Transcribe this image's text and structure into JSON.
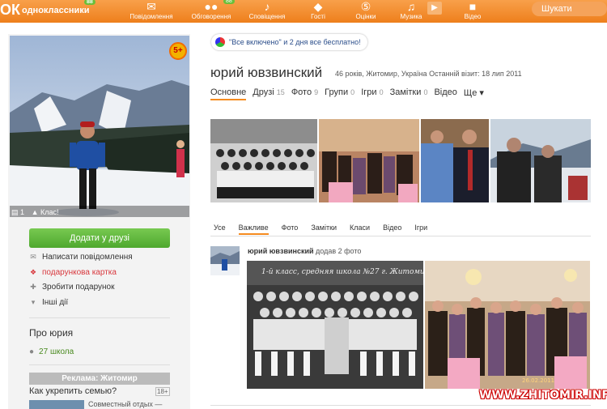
{
  "logo": {
    "text": "одноклассники",
    "badge": "88"
  },
  "nav": [
    {
      "label": "Повідомлення",
      "icon": "envelope-icon"
    },
    {
      "label": "Обговорення",
      "icon": "chat-bubbles-icon",
      "count": "88"
    },
    {
      "label": "Сповіщення",
      "icon": "bell-icon"
    },
    {
      "label": "Гості",
      "icon": "footprints-icon"
    },
    {
      "label": "Оцінки",
      "icon": "rating-icon",
      "count": "5"
    },
    {
      "label": "Музика",
      "icon": "music-note-icon"
    },
    {
      "label": "Відео",
      "icon": "video-camera-icon"
    }
  ],
  "search": {
    "placeholder": "Шукати"
  },
  "profile": {
    "rating_badge": "5+",
    "comments_count": "1",
    "like_label": "Клас!",
    "add_friend": "Додати у друзі",
    "actions": [
      {
        "label": "Написати повідомлення",
        "icon": "envelope-icon"
      },
      {
        "label": "подарункова картка",
        "icon": "gift-card-icon"
      },
      {
        "label": "Зробити подарунок",
        "icon": "gift-icon"
      },
      {
        "label": "Інші дії",
        "icon": "chevron-down-icon"
      }
    ],
    "about_title": "Про юрия",
    "school": "27 школа"
  },
  "ad": {
    "header": "Реклама: Житомир",
    "question": "Как укрепить семью?",
    "age": "18+",
    "teaser": "Совместный отдых —"
  },
  "promo": {
    "text": "\"Все включено\" и 2 дня все бесплатно!"
  },
  "user": {
    "name": "юрий ювзвинский",
    "meta": "46 років, Житомир, Україна  Останній візит: 18 лип 2011"
  },
  "tabs": [
    {
      "label": "Основне",
      "count": ""
    },
    {
      "label": "Друзі",
      "count": "15"
    },
    {
      "label": "Фото",
      "count": "9"
    },
    {
      "label": "Групи",
      "count": "0"
    },
    {
      "label": "Ігри",
      "count": "0"
    },
    {
      "label": "Замітки",
      "count": "0"
    },
    {
      "label": "Відео",
      "count": ""
    },
    {
      "label": "Ще ▾",
      "count": ""
    }
  ],
  "feed_tabs": [
    "Усе",
    "Важливе",
    "Фото",
    "Замітки",
    "Класи",
    "Відео",
    "Ігри"
  ],
  "feed": {
    "author": "юрий ювзвинский",
    "action": "додав 2 фото",
    "photo1_caption": "1-й класс,  средняя школа №27  г. Житомир",
    "photo2_date": "26.02.2011"
  },
  "watermark": "WWW.ZHITOMIR.INFO"
}
